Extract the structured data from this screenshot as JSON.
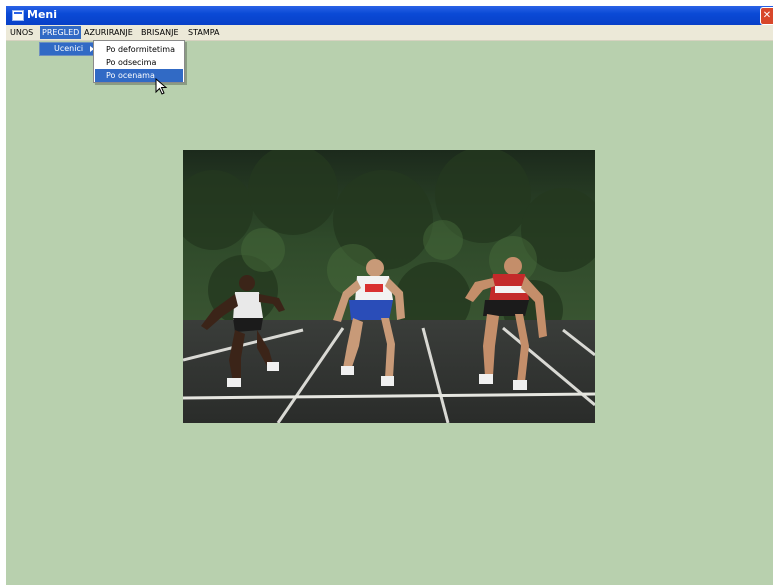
{
  "window": {
    "title": "Meni",
    "close_glyph": "✕"
  },
  "menubar": {
    "items": [
      {
        "label": "UNOS"
      },
      {
        "label": "PREGLED"
      },
      {
        "label": "AZURIRANJE"
      },
      {
        "label": "BRISANJE"
      },
      {
        "label": "STAMPA"
      }
    ]
  },
  "submenu": {
    "label": "Ucenici"
  },
  "dropdown": {
    "items": [
      {
        "label": "Po deformitetima"
      },
      {
        "label": "Po odsecima"
      },
      {
        "label": "Po ocenama"
      }
    ]
  },
  "colors": {
    "title_bar": "#0a4ad6",
    "menu_highlight": "#316ac5",
    "client_background": "#b8d0ae"
  },
  "icons": {
    "window_icon": "app-window-icon",
    "close_icon": "close-icon",
    "submenu_arrow": "arrow-right-icon",
    "cursor": "mouse-cursor-icon"
  }
}
